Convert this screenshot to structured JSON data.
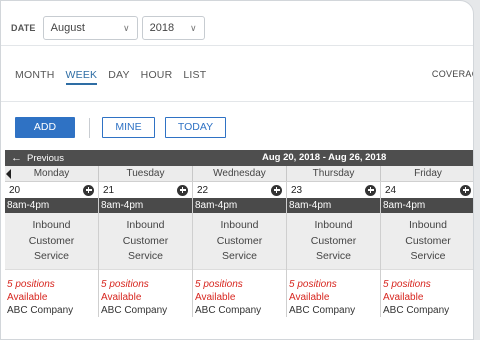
{
  "date_filter": {
    "label": "DATE",
    "month": "August",
    "year": "2018"
  },
  "view_tabs": [
    {
      "label": "MONTH",
      "active": false
    },
    {
      "label": "WEEK",
      "active": true
    },
    {
      "label": "DAY",
      "active": false
    },
    {
      "label": "HOUR",
      "active": false
    },
    {
      "label": "LIST",
      "active": false
    }
  ],
  "coverage_label": "COVERAG",
  "actions": {
    "add": "ADD",
    "mine": "MINE",
    "today": "TODAY"
  },
  "calendar": {
    "previous_label": "Previous",
    "range": "Aug 20, 2018 - Aug 26, 2018",
    "days": [
      {
        "name": "Monday",
        "date": "20",
        "shift_time": "8am-4pm",
        "shift_lines": [
          "Inbound",
          "Customer",
          "Service"
        ],
        "positions": "5 positions",
        "status": "Available",
        "company": "ABC Company"
      },
      {
        "name": "Tuesday",
        "date": "21",
        "shift_time": "8am-4pm",
        "shift_lines": [
          "Inbound",
          "Customer",
          "Service"
        ],
        "positions": "5 positions",
        "status": "Available",
        "company": "ABC Company"
      },
      {
        "name": "Wednesday",
        "date": "22",
        "shift_time": "8am-4pm",
        "shift_lines": [
          "Inbound",
          "Customer",
          "Service"
        ],
        "positions": "5 positions",
        "status": "Available",
        "company": "ABC Company"
      },
      {
        "name": "Thursday",
        "date": "23",
        "shift_time": "8am-4pm",
        "shift_lines": [
          "Inbound",
          "Customer",
          "Service"
        ],
        "positions": "5 positions",
        "status": "Available",
        "company": "ABC Company"
      },
      {
        "name": "Friday",
        "date": "24",
        "shift_time": "8am-4pm",
        "shift_lines": [
          "Inbound",
          "Customer",
          "Service"
        ],
        "positions": "5 positions",
        "status": "Available",
        "company": "ABC Company"
      }
    ]
  },
  "colors": {
    "accent": "#2f72c4",
    "header_bar": "#4e4e4e",
    "alert_text": "#d7261f"
  }
}
